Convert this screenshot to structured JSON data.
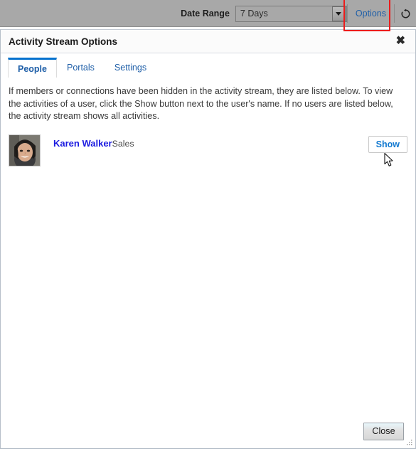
{
  "toolbar": {
    "date_range_label": "Date Range",
    "date_range_value": "7 Days",
    "date_range_options": [
      "7 Days"
    ],
    "options_link": "Options",
    "refresh_icon": "refresh-icon",
    "dropdown_icon": "chevron-down-icon"
  },
  "annotation": {
    "color": "#ec1c1c",
    "target": "Options"
  },
  "dialog": {
    "title": "Activity Stream Options",
    "close_icon": "close-icon",
    "tabs": [
      {
        "label": "People",
        "active": true
      },
      {
        "label": "Portals",
        "active": false
      },
      {
        "label": "Settings",
        "active": false
      }
    ],
    "description": "If members or connections have been hidden in the activity stream, they are listed below. To view the activities of a user, click the Show button next to the user's name. If no users are listed below, the activity stream shows all activities.",
    "users": [
      {
        "name": "Karen Walker",
        "department": "Sales",
        "action_label": "Show",
        "avatar": "user-photo"
      }
    ],
    "footer": {
      "close_label": "Close"
    }
  },
  "colors": {
    "toolbar_bg": "#a8a8a8",
    "link_blue": "#1f5fa8",
    "tab_active_border": "#0572ce",
    "user_name_blue": "#1a1ae0",
    "annotation_red": "#ec1c1c"
  }
}
